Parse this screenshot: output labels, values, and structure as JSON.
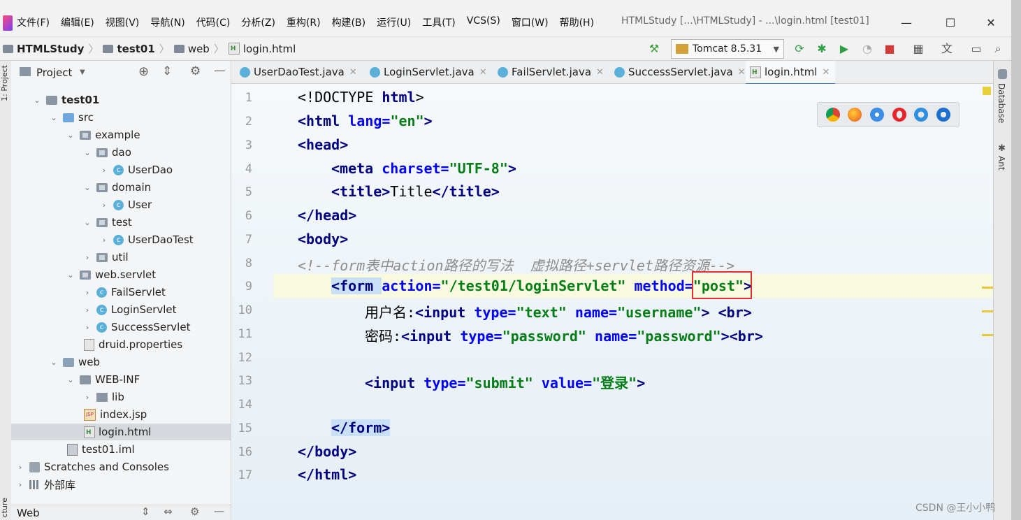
{
  "menu": [
    "文件(F)",
    "编辑(E)",
    "视图(V)",
    "导航(N)",
    "代码(C)",
    "分析(Z)",
    "重构(R)",
    "构建(B)",
    "运行(U)",
    "工具(T)",
    "VCS(S)",
    "窗口(W)",
    "帮助(H)"
  ],
  "window_title": "HTMLStudy [...\\HTMLStudy] - ...\\login.html [test01]",
  "window_controls": {
    "minimize": "—",
    "maximize": "☐",
    "close": "✕"
  },
  "breadcrumb": [
    "HTMLStudy",
    "test01",
    "web",
    "login.html"
  ],
  "run_config": "Tomcat 8.5.31",
  "left_strip_label": "1: Project",
  "bottom_strip_label": "cture",
  "project_panel": {
    "title": "Project"
  },
  "tree": [
    {
      "label": "test01",
      "bold": true
    },
    {
      "label": "src"
    },
    {
      "label": "example"
    },
    {
      "label": "dao"
    },
    {
      "label": "UserDao"
    },
    {
      "label": "domain"
    },
    {
      "label": "User"
    },
    {
      "label": "test"
    },
    {
      "label": "UserDaoTest"
    },
    {
      "label": "util"
    },
    {
      "label": "web.servlet"
    },
    {
      "label": "FailServlet"
    },
    {
      "label": "LoginServlet"
    },
    {
      "label": "SuccessServlet"
    },
    {
      "label": "druid.properties"
    },
    {
      "label": "web"
    },
    {
      "label": "WEB-INF"
    },
    {
      "label": "lib"
    },
    {
      "label": "index.jsp"
    },
    {
      "label": "login.html",
      "selected": true
    },
    {
      "label": "test01.iml"
    },
    {
      "label": "Scratches and Consoles"
    },
    {
      "label": "外部库"
    }
  ],
  "web_panel_label": "Web",
  "tabs": [
    "UserDaoTest.java",
    "LoginServlet.java",
    "FailServlet.java",
    "SuccessServlet.java",
    "login.html"
  ],
  "active_tab": "login.html",
  "line_numbers": [
    "1",
    "2",
    "3",
    "4",
    "5",
    "6",
    "7",
    "8",
    "9",
    "10",
    "11",
    "12",
    "13",
    "14",
    "15",
    "16",
    "17"
  ],
  "code": {
    "doctype_tag": "<!DOCTYPE ",
    "doctype_name": "html",
    ">": ">",
    "html_open": "<html ",
    "lang_attr": "lang=",
    "lang_val": "\"en\"",
    "head_open": "<head>",
    "meta_open": "<meta ",
    "charset_attr": "charset=",
    "charset_val": "\"UTF-8\"",
    "title_open": "<title>",
    "title_text": "Title",
    "title_close": "</title>",
    "head_close": "</head>",
    "body_open": "<body>",
    "comment": "<!--form表中action路径的写法  虚拟路径+servlet路径资源-->",
    "form_open": "<form ",
    "action_attr": "action=",
    "action_val": "\"/test01/loginServlet\"",
    "method_attr": " method=",
    "method_val": "\"post\"",
    "username_label": "用户名:",
    "input_tag": "<input ",
    "type_attr": "type=",
    "text_val": "\"text\"",
    "name_attr": " name=",
    "username_val": "\"username\"",
    "br_tag": "<br>",
    "password_label": "密码:",
    "password_type_val": "\"password\"",
    "password_name_val": "\"password\"",
    "submit_type_val": "\"submit\"",
    "value_attr": " value=",
    "submit_value_val": "\"登录\"",
    "form_close": "</form>",
    "body_close": "</body>",
    "html_close": "</html>"
  },
  "right_strip": [
    "Database",
    "Ant"
  ],
  "watermark": "CSDN @王小小鸭"
}
